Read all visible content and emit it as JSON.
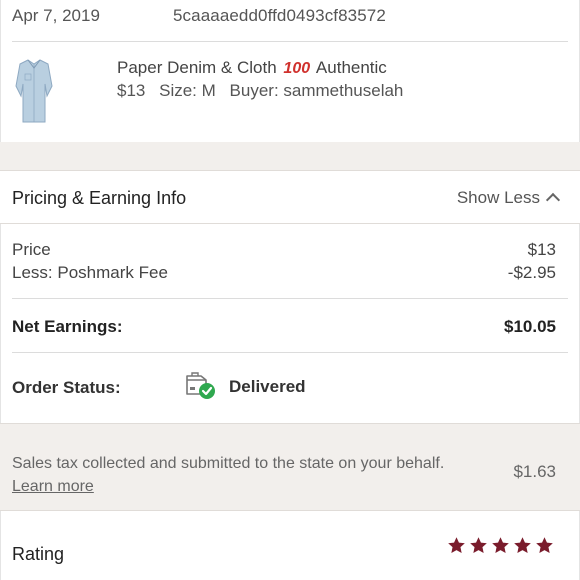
{
  "order": {
    "date": "Apr 7, 2019",
    "id": "5caaaaedd0ffd0493cf83572"
  },
  "item": {
    "brand": "Paper Denim & Cloth",
    "hundred_emoji": "100",
    "authenticity": "Authentic",
    "price": "$13",
    "size": "Size: M",
    "buyer": "Buyer: sammethuselah"
  },
  "pricing": {
    "title": "Pricing & Earning Info",
    "toggle_label": "Show Less",
    "price_label": "Price",
    "price_value": "$13",
    "fee_label": "Less: Poshmark Fee",
    "fee_value": "-$2.95",
    "net_label": "Net Earnings:",
    "net_value": "$10.05"
  },
  "status": {
    "label": "Order Status:",
    "value": "Delivered",
    "icon": "package-delivered-icon",
    "check_color": "#2fa84f"
  },
  "tax": {
    "text": "Sales tax collected and submitted to the state on your behalf.",
    "link": "Learn more",
    "amount": "$1.63"
  },
  "rating": {
    "label": "Rating",
    "stars": 5,
    "star_color": "#7a1c2c"
  },
  "colors": {
    "band": "#f2efec",
    "accent": "#7a1c2c"
  }
}
